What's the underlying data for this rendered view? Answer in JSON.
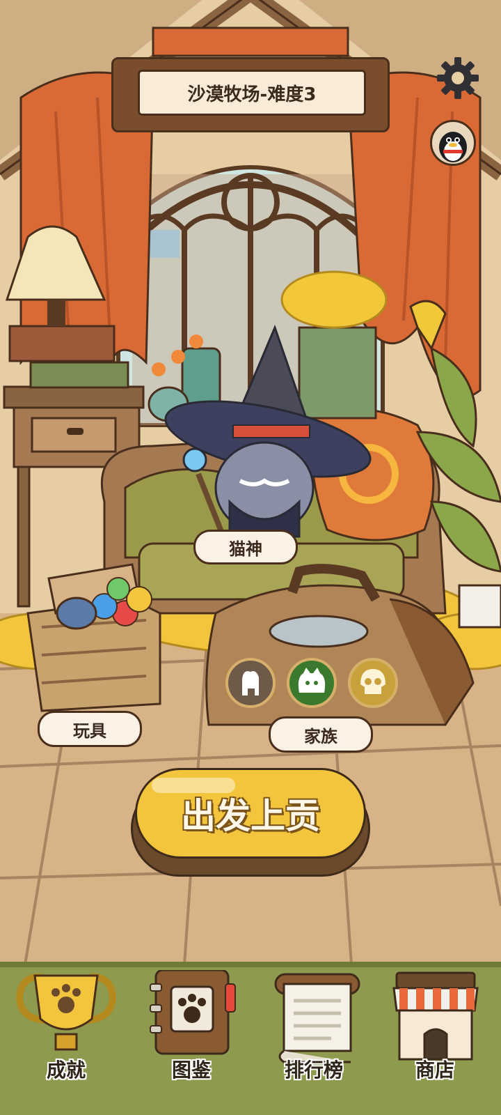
{
  "stage": {
    "title": "沙漠牧场-难度3"
  },
  "characters": {
    "cat_god_label": "猫神"
  },
  "objects": {
    "toys_label": "玩具",
    "family_label": "家族"
  },
  "actions": {
    "depart_label": "出发上贡"
  },
  "bottom_nav": {
    "items": [
      {
        "label": "成就",
        "icon": "trophy-icon"
      },
      {
        "label": "图鉴",
        "icon": "catalog-book-icon"
      },
      {
        "label": "排行榜",
        "icon": "scroll-icon"
      },
      {
        "label": "商店",
        "icon": "shop-icon"
      }
    ]
  },
  "top_right": {
    "settings_icon": "gear-icon",
    "profile_icon": "penguin-avatar-icon"
  },
  "bag_slots": [
    {
      "icon": "cat-silhouette-icon",
      "color": "#6e5a48"
    },
    {
      "icon": "cat-face-icon",
      "color": "#3b7a2e"
    },
    {
      "icon": "skull-icon",
      "color": "#c9a13a"
    }
  ],
  "colors": {
    "accent": "#f2c53c",
    "curtain": "#d96a35",
    "outline": "#4a2e1c"
  }
}
